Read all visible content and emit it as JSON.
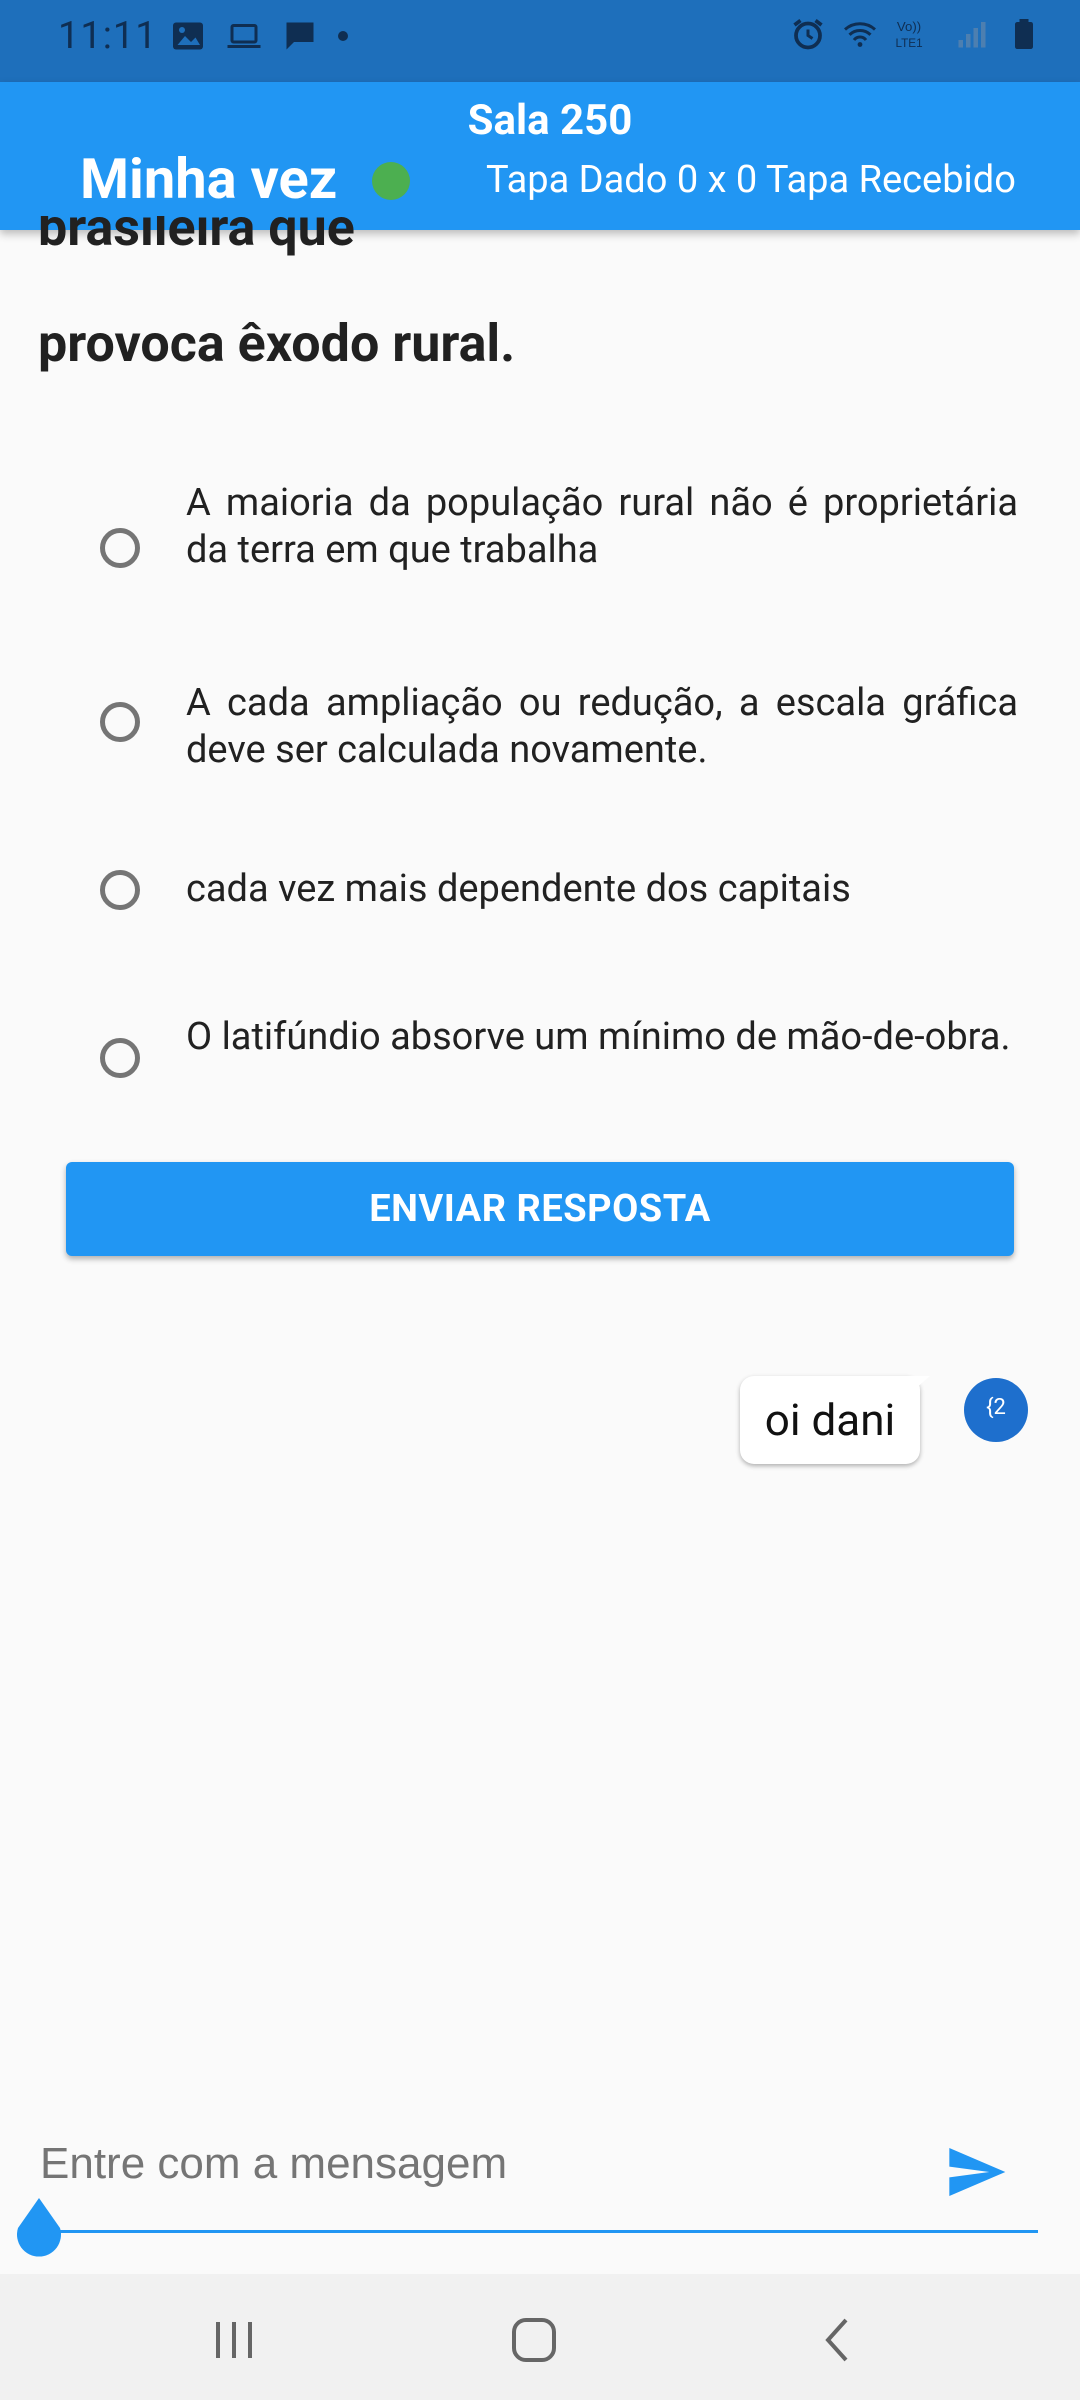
{
  "status_bar": {
    "time": "11:11",
    "left_icons": [
      "image-icon",
      "laptop-icon",
      "chat-icon",
      "dot-icon"
    ],
    "right_icons": [
      "alarm-icon",
      "wifi-icon",
      "volte-icon",
      "signal-icon",
      "battery-icon"
    ]
  },
  "header": {
    "room": "Sala 250",
    "turn_label": "Minha vez",
    "score": "Tapa Dado 0 x 0 Tapa Recebido",
    "status_color": "#4caf50"
  },
  "question": {
    "partial_line": "brasileira que",
    "line": "provoca êxodo rural."
  },
  "options": [
    {
      "text": "A maioria da população rural não é proprietária da terra em que trabalha"
    },
    {
      "text": "A cada ampliação ou redução, a escala gráfica deve ser calculada novamente."
    },
    {
      "text": "cada vez mais dependente dos capitais"
    },
    {
      "text": "O latifúndio absorve um mínimo de mão-de-obra."
    }
  ],
  "submit_label": "ENVIAR RESPOSTA",
  "chat": {
    "message": "oi dani",
    "avatar_text": "{2"
  },
  "input": {
    "placeholder": "Entre com a mensagem"
  },
  "colors": {
    "accent": "#2196f3",
    "status_bar": "#1e6fbb"
  }
}
